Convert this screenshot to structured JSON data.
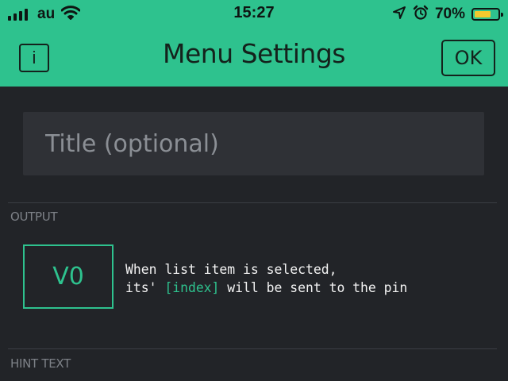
{
  "status_bar": {
    "carrier": "au",
    "time": "15:27",
    "battery_percent": "70%",
    "battery_level": 0.7,
    "icons": [
      "signal-icon",
      "wifi-icon",
      "location-arrow-icon",
      "alarm-clock-icon",
      "battery-icon"
    ]
  },
  "header": {
    "info_label": "i",
    "title": "Menu Settings",
    "ok_label": "OK"
  },
  "title_field": {
    "placeholder": "Title (optional)",
    "value": ""
  },
  "output": {
    "label": "OUTPUT",
    "pin": "V0",
    "line1": "When list item is selected,",
    "line2_prefix": "its' ",
    "line2_highlight": "[index]",
    "line2_suffix": " will be sent to the pin"
  },
  "hint": {
    "label": "HINT TEXT"
  },
  "colors": {
    "accent": "#2ec28e",
    "background": "#222428",
    "input_background": "#2f3136",
    "battery": "#f3c92e"
  }
}
